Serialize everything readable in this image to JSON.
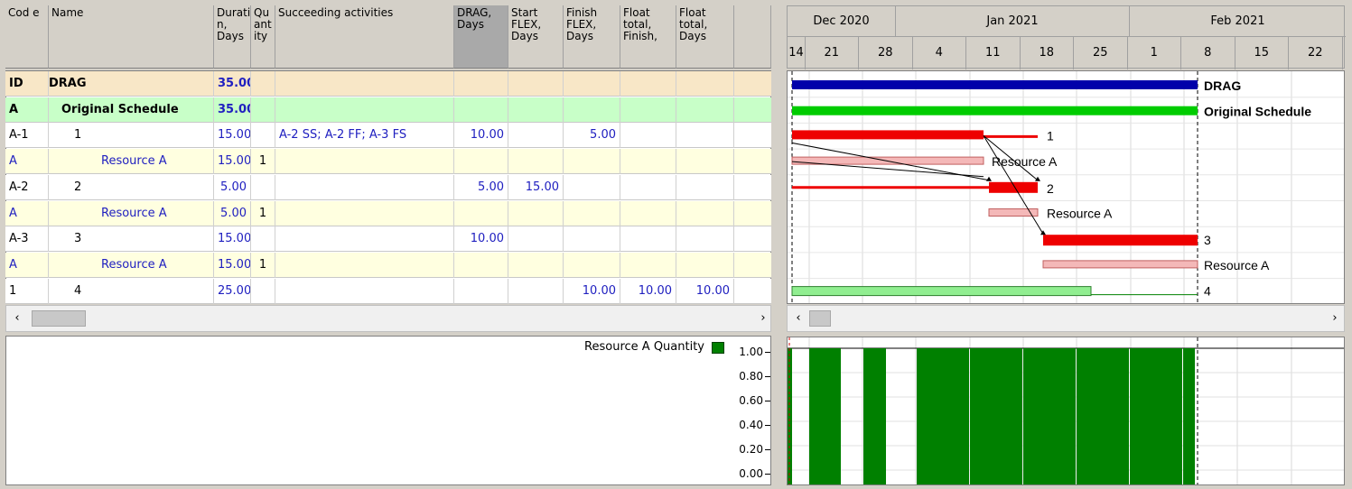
{
  "columns": {
    "code": "Cod e",
    "name": "Name",
    "duration": "Duratio n, Days",
    "quantity": "Qu ant ity",
    "successors": "Succeeding activities",
    "drag": "DRAG, Days",
    "start_flex": "Start FLEX, Days",
    "finish_flex": "Finish FLEX, Days",
    "float_finish": "Float total, Finish,",
    "float_days": "Float total, Days"
  },
  "rows": [
    {
      "code": "ID",
      "name": "DRAG",
      "duration": "35.00",
      "quantity": "",
      "successors": "",
      "drag": "",
      "start_flex": "",
      "finish_flex": "",
      "float_finish": "",
      "float_days": ""
    },
    {
      "code": "A",
      "name": "Original Schedule",
      "duration": "35.00",
      "quantity": "",
      "successors": "",
      "drag": "",
      "start_flex": "",
      "finish_flex": "",
      "float_finish": "",
      "float_days": ""
    },
    {
      "code": "A-1",
      "name": "1",
      "duration": "15.00",
      "quantity": "",
      "successors": "A-2 SS; A-2 FF; A-3 FS",
      "drag": "10.00",
      "start_flex": "",
      "finish_flex": "5.00",
      "float_finish": "",
      "float_days": ""
    },
    {
      "code": "A",
      "name": "Resource A",
      "duration": "15.00",
      "quantity": "1",
      "successors": "",
      "drag": "",
      "start_flex": "",
      "finish_flex": "",
      "float_finish": "",
      "float_days": ""
    },
    {
      "code": "A-2",
      "name": "2",
      "duration": "5.00",
      "quantity": "",
      "successors": "",
      "drag": "5.00",
      "start_flex": "15.00",
      "finish_flex": "",
      "float_finish": "",
      "float_days": ""
    },
    {
      "code": "A",
      "name": "Resource A",
      "duration": "5.00",
      "quantity": "1",
      "successors": "",
      "drag": "",
      "start_flex": "",
      "finish_flex": "",
      "float_finish": "",
      "float_days": ""
    },
    {
      "code": "A-3",
      "name": "3",
      "duration": "15.00",
      "quantity": "",
      "successors": "",
      "drag": "10.00",
      "start_flex": "",
      "finish_flex": "",
      "float_finish": "",
      "float_days": ""
    },
    {
      "code": "A",
      "name": "Resource A",
      "duration": "15.00",
      "quantity": "1",
      "successors": "",
      "drag": "",
      "start_flex": "",
      "finish_flex": "",
      "float_finish": "",
      "float_days": ""
    },
    {
      "code": "1",
      "name": "4",
      "duration": "25.00",
      "quantity": "",
      "successors": "",
      "drag": "",
      "start_flex": "",
      "finish_flex": "10.00",
      "float_finish": "10.00",
      "float_days": "10.00"
    }
  ],
  "timeline": {
    "months": [
      "Dec 2020",
      "Jan 2021",
      "Feb 2021"
    ],
    "weeks": [
      "14",
      "21",
      "28",
      "4",
      "11",
      "18",
      "25",
      "1",
      "8",
      "15",
      "22"
    ]
  },
  "gantt_labels": {
    "drag": "DRAG",
    "original": "Original Schedule",
    "a1": "1",
    "a1_res": "Resource A",
    "a2": "2",
    "a2_res": "Resource A",
    "a3": "3",
    "a3_res": "Resource A",
    "a4": "4"
  },
  "histogram": {
    "legend": "Resource A Quantity",
    "legend_color": "#008000",
    "ticks": [
      "1.00",
      "0.80",
      "0.60",
      "0.40",
      "0.20",
      "0.00"
    ]
  },
  "colors": {
    "drag_bar": "#0000aa",
    "original_bar": "#00cc00",
    "critical_bar": "#ee0000",
    "resource_bar": "#f4b8b8",
    "noncritical_bar": "#90ee90",
    "row_drag_bg": "#f8e7c7",
    "row_orig_bg": "#c8ffc8",
    "row_res_bg": "#ffffe0"
  }
}
